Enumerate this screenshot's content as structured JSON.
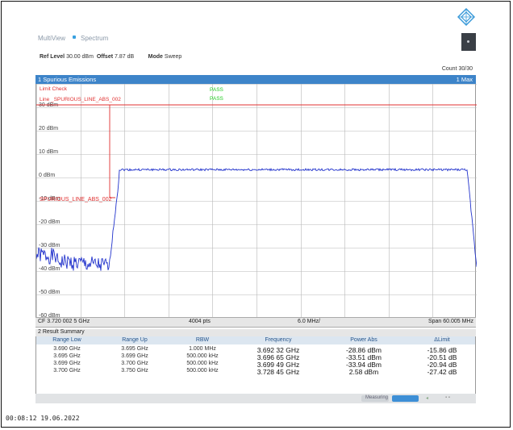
{
  "tabs": {
    "multiview": "MultiView",
    "spectrum": "Spectrum"
  },
  "settings": {
    "ref_level_label": "Ref Level",
    "ref_level_value": "30.00 dBm",
    "offset_label": "Offset",
    "offset_value": "7.87 dB",
    "mode_label": "Mode",
    "mode_value": "Sweep"
  },
  "count": "Count 30/30",
  "window1": {
    "title": "1 Spurious Emissions",
    "trace": "1 Max"
  },
  "limit": {
    "check_label": "Limit Check",
    "line_label": "Line _SPURIOUS_LINE_ABS_002",
    "pass1": "PASS",
    "pass2": "PASS",
    "line_marker": "SPURIOUS_LINE_ABS_002"
  },
  "y_ticks": [
    "30 dBm",
    "20 dBm",
    "10 dBm",
    "0 dBm",
    "-10 dBm",
    "-20 dBm",
    "-30 dBm",
    "-40 dBm",
    "-50 dBm",
    "-60 dBm"
  ],
  "status": {
    "cf": "CF 3.720 002 5 GHz",
    "pts": "4004 pts",
    "div": "6.0 MHz/",
    "span": "Span 60.005 MHz"
  },
  "result_summary": {
    "title": "2 Result Summary",
    "headers": [
      "Range Low",
      "Range Up",
      "RBW",
      "Frequency",
      "Power Abs",
      "ΔLimit"
    ],
    "rows": [
      [
        "3.690 GHz",
        "3.695 GHz",
        "1.000 MHz",
        "3.692 32 GHz",
        "-28.86 dBm",
        "-15.86 dB"
      ],
      [
        "3.695 GHz",
        "3.699 GHz",
        "500.000 kHz",
        "3.696 65 GHz",
        "-33.51 dBm",
        "-20.51 dB"
      ],
      [
        "3.699 GHz",
        "3.700 GHz",
        "500.000 kHz",
        "3.699 49 GHz",
        "-33.94 dBm",
        "-20.94 dB"
      ],
      [
        "3.700 GHz",
        "3.750 GHz",
        "500.000 kHz",
        "3.728 45 GHz",
        "2.58 dBm",
        "-27.42 dB"
      ]
    ]
  },
  "bottom": {
    "measuring": "Measuring"
  },
  "timestamp": "00:08:12  19.06.2022",
  "colors": {
    "header": "#3d84c9",
    "trace": "#2233cc",
    "limit": "#e03030",
    "pass": "#22cc22",
    "grid": "#b8b8b8"
  }
}
